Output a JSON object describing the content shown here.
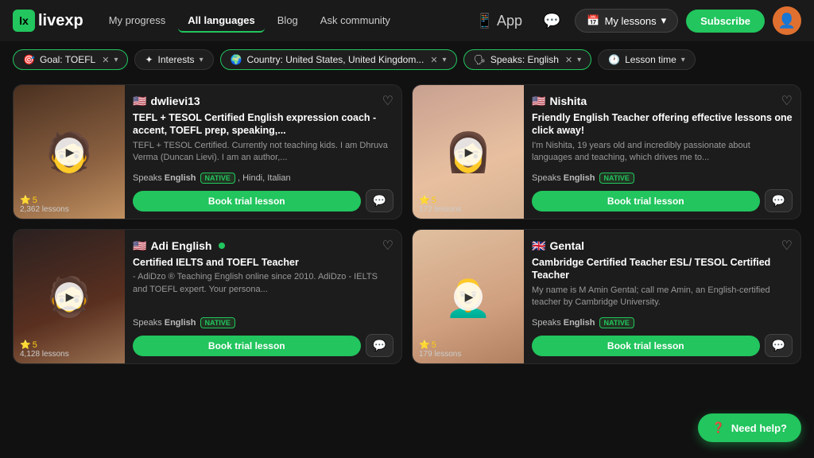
{
  "logo": {
    "text": "livexp",
    "icon_text": "lx"
  },
  "nav": {
    "links": [
      {
        "label": "My progress",
        "active": false
      },
      {
        "label": "All languages",
        "active": true
      },
      {
        "label": "Blog",
        "active": false
      },
      {
        "label": "Ask community",
        "active": false
      }
    ],
    "app_label": "App",
    "my_lessons_label": "My lessons",
    "subscribe_label": "Subscribe"
  },
  "filters": [
    {
      "id": "goal",
      "icon": "🎯",
      "label": "Goal: TOEFL",
      "removable": true,
      "has_arrow": true,
      "active": true
    },
    {
      "id": "interests",
      "icon": "✦",
      "label": "Interests",
      "removable": false,
      "has_arrow": true,
      "active": false
    },
    {
      "id": "country",
      "icon": "🌍",
      "label": "Country: United States, United Kingdom...",
      "removable": true,
      "has_arrow": true,
      "active": true
    },
    {
      "id": "speaks",
      "icon": "🗣",
      "label": "Speaks: English",
      "removable": true,
      "has_arrow": true,
      "active": true
    },
    {
      "id": "lesson_time",
      "icon": "🕐",
      "label": "Lesson time",
      "removable": false,
      "has_arrow": true,
      "active": false
    }
  ],
  "tutors": [
    {
      "id": 1,
      "username": "dwlievi13",
      "flag": "🇺🇸",
      "title": "TEFL + TESOL Certified English expression coach - accent, TOEFL prep, speaking,...",
      "desc": "TEFL + TESOL Certified. Currently not teaching kids. I am Dhruva Verma (Duncan Lievi). I am an author,...",
      "speaks": "English",
      "speaks_badge": "NATIVE",
      "extra_langs": "Hindi, Italian",
      "rating": "5",
      "lessons": "2,362 lessons",
      "book_label": "Book trial lesson",
      "thumb_class": "thumb-1",
      "online": false
    },
    {
      "id": 2,
      "username": "Nishita",
      "flag": "🇺🇸",
      "title": "Friendly English Teacher offering effective lessons one click away!",
      "desc": "I'm Nishita, 19 years old and incredibly passionate about languages and teaching, which drives me to...",
      "speaks": "English",
      "speaks_badge": "NATIVE",
      "extra_langs": "",
      "rating": "5",
      "lessons": "172 lessons",
      "book_label": "Book trial lesson",
      "thumb_class": "thumb-2",
      "online": false
    },
    {
      "id": 3,
      "username": "Adi English",
      "flag": "🇺🇸",
      "title": "Certified IELTS and TOEFL Teacher",
      "desc": "- AdiDzo ® Teaching English online since 2010. AdiDzo - IELTS and TOEFL expert. Your persona...",
      "speaks": "English",
      "speaks_badge": "NATIVE",
      "extra_langs": "",
      "rating": "5",
      "lessons": "4,128 lessons",
      "book_label": "Book trial lesson",
      "thumb_class": "thumb-3",
      "online": true
    },
    {
      "id": 4,
      "username": "Gental",
      "flag": "🇬🇧",
      "title": "Cambridge Certified Teacher ESL/ TESOL Certified Teacher",
      "desc": "My name is M Amin Gental; call me Amin, an English-certified teacher by Cambridge University.",
      "speaks": "English",
      "speaks_badge": "NATIVE",
      "extra_langs": "",
      "rating": "5",
      "lessons": "179 lessons",
      "book_label": "Book trial lesson",
      "thumb_class": "thumb-4",
      "online": false
    }
  ],
  "need_help": {
    "label": "Need help?"
  }
}
